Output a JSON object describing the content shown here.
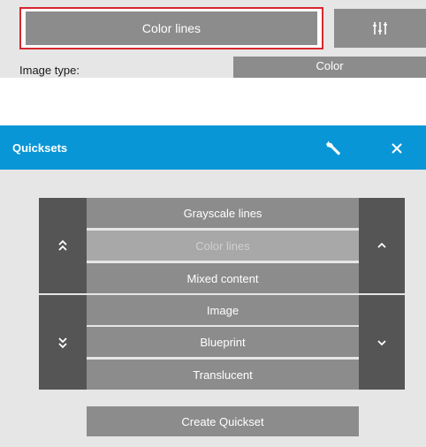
{
  "top": {
    "current_quickset": "Color lines",
    "image_type_label": "Image type:",
    "image_type_value": "Color",
    "settings_icon": "sliders-icon"
  },
  "dialog": {
    "title": "Quicksets",
    "wrench_icon": "wrench-icon",
    "close_icon": "close-icon",
    "presets": [
      {
        "label": "Grayscale lines",
        "selected": false
      },
      {
        "label": "Color lines",
        "selected": true
      },
      {
        "label": "Mixed content",
        "selected": false
      },
      {
        "label": "Image",
        "selected": false
      },
      {
        "label": "Blueprint",
        "selected": false
      },
      {
        "label": "Translucent",
        "selected": false
      }
    ],
    "create_button": "Create Quickset"
  },
  "colors": {
    "header_blue": "#0996d6",
    "highlight_red": "#d8262e",
    "button_gray": "#8c8c8c",
    "dark_gray": "#555555"
  }
}
